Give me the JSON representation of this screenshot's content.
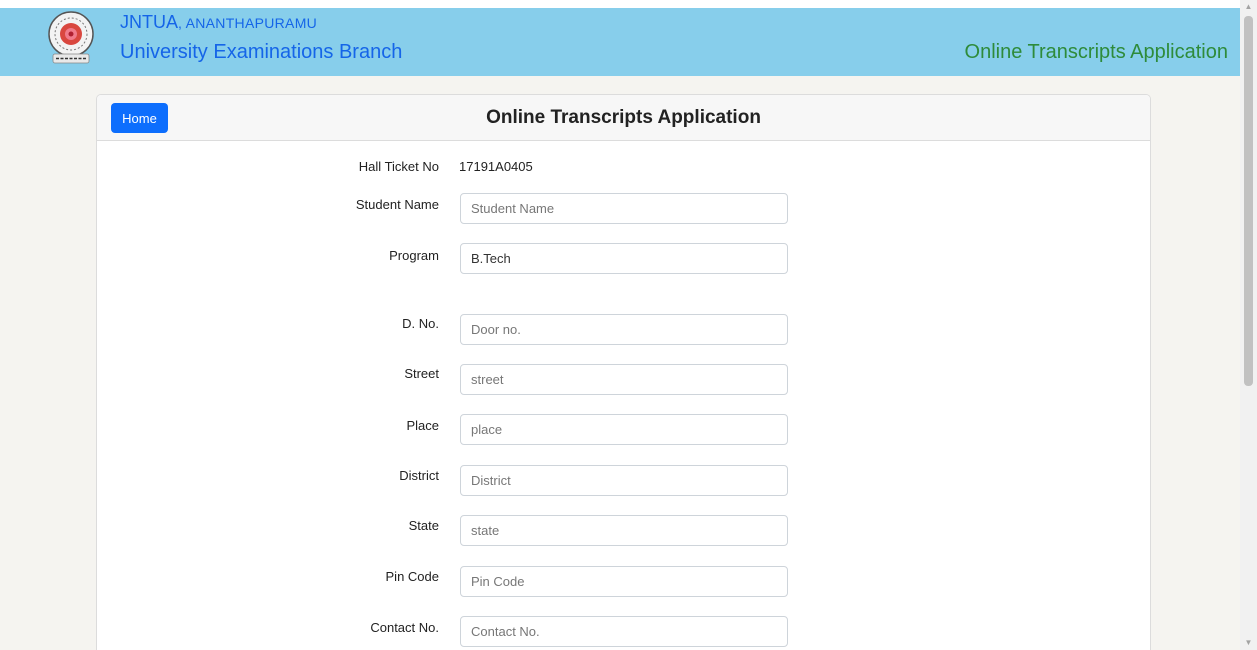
{
  "header": {
    "brand_name": "JNTUA",
    "brand_city": ", ANANTHAPURAMU",
    "subtitle": "University Examinations Branch",
    "right_title": "Online Transcripts Application",
    "bg_color": "#87ceeb",
    "brand_color": "#1565e8",
    "right_title_color": "#2e8b3a"
  },
  "card": {
    "home_label": "Home",
    "title": "Online Transcripts Application"
  },
  "form": {
    "hall_ticket": {
      "label": "Hall Ticket No",
      "value": "17191A0405"
    },
    "student_name": {
      "label": "Student Name",
      "placeholder": "Student Name",
      "value": ""
    },
    "program": {
      "label": "Program",
      "value": "B.Tech"
    },
    "door_no": {
      "label": "D. No.",
      "placeholder": "Door no.",
      "value": ""
    },
    "street": {
      "label": "Street",
      "placeholder": "street",
      "value": ""
    },
    "place": {
      "label": "Place",
      "placeholder": "place",
      "value": ""
    },
    "district": {
      "label": "District",
      "placeholder": "District",
      "value": ""
    },
    "state": {
      "label": "State",
      "placeholder": "state",
      "value": ""
    },
    "pin_code": {
      "label": "Pin Code",
      "placeholder": "Pin Code",
      "value": ""
    },
    "contact_no": {
      "label": "Contact No.",
      "placeholder": "Contact No.",
      "value": ""
    }
  }
}
